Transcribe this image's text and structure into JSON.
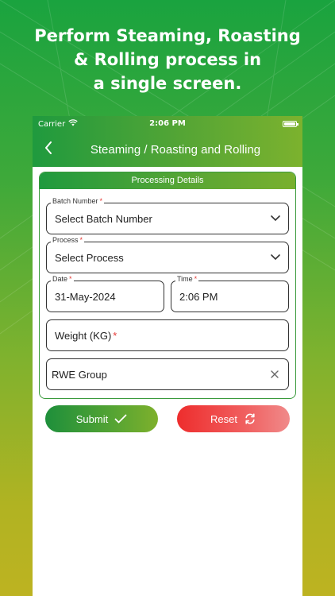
{
  "promo": {
    "line1": "Perform Steaming, Roasting",
    "line2": "& Rolling process in",
    "line3": "a single screen."
  },
  "status_bar": {
    "carrier": "Carrier",
    "time": "2:06 PM"
  },
  "app_bar": {
    "title": "Steaming / Roasting and Rolling"
  },
  "card": {
    "header": "Processing Details"
  },
  "form": {
    "batch": {
      "label": "Batch Number",
      "required_mark": "*",
      "value": "Select Batch Number"
    },
    "process": {
      "label": "Process",
      "required_mark": "*",
      "value": "Select Process"
    },
    "date": {
      "label": "Date",
      "required_mark": "*",
      "value": "31-May-2024"
    },
    "time": {
      "label": "Time",
      "required_mark": "*",
      "value": "2:06 PM"
    },
    "weight": {
      "label": "Weight (KG)",
      "required_mark": "*"
    },
    "group": {
      "value": "RWE Group"
    }
  },
  "buttons": {
    "submit_label": "Submit",
    "reset_label": "Reset"
  },
  "colors": {
    "primary_green": "#1f9a3e",
    "accent_olive": "#7cb22e",
    "reset_red": "#ee2d2d",
    "required_red": "#e53935"
  },
  "icons": {
    "back": "chevron-left-icon",
    "wifi": "wifi-icon",
    "battery": "battery-icon",
    "dropdown": "chevron-down-icon",
    "clear": "close-icon",
    "submit": "checkmark-icon",
    "reset": "refresh-icon"
  }
}
